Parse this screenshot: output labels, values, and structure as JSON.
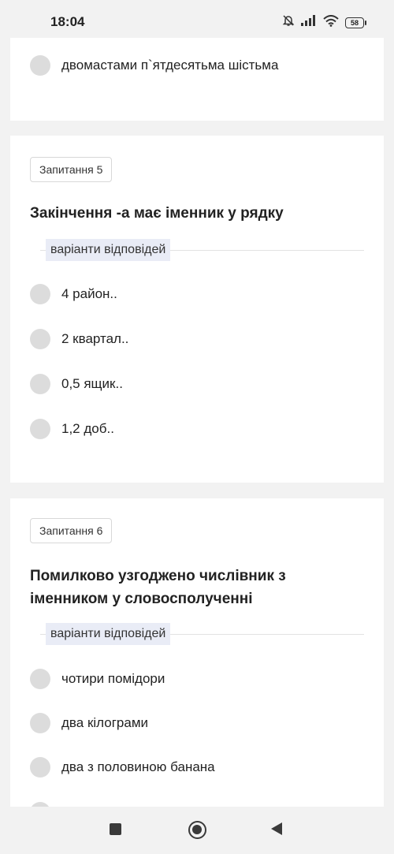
{
  "status_bar": {
    "time": "18:04",
    "battery": "58",
    "icons": [
      "mute-bell-icon",
      "signal-icon",
      "wifi-icon",
      "battery-icon"
    ]
  },
  "top_card": {
    "option_label": "двомастами п`ятдесятьма шістьма"
  },
  "question5": {
    "badge": "Запитання 5",
    "text": "Закінчення -а має іменник у рядку",
    "answers_label": "варіанти відповідей",
    "options": [
      "4 район..",
      "2 квартал..",
      "0,5 ящик..",
      "1,2 доб.."
    ]
  },
  "question6": {
    "badge": "Запитання 6",
    "text_line1": "Помилково узгоджено числівник з",
    "text_line2": "іменником у словосполученні",
    "answers_label": "варіанти відповідей",
    "options": [
      "чотири помідори",
      "два кілограми",
      "два з половиною банана"
    ]
  },
  "nav_bar": {
    "buttons": [
      "recent-apps-square-icon",
      "home-circle-icon",
      "back-triangle-icon"
    ]
  },
  "colors": {
    "background": "#f2f2f2",
    "card": "#ffffff",
    "radio": "#dcdcdc",
    "answers_label_bg": "#e9ecf6"
  }
}
